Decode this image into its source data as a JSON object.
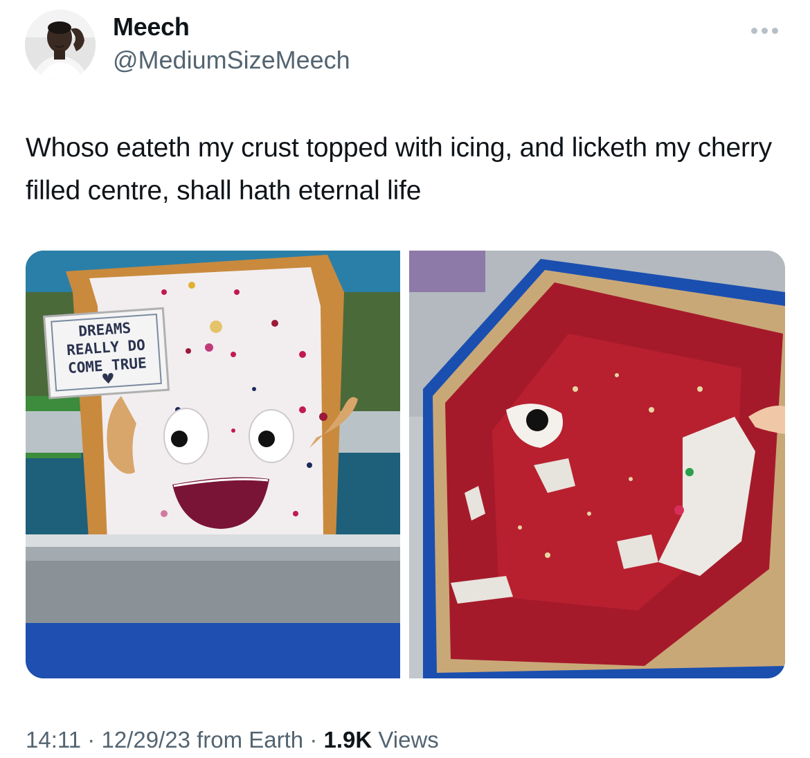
{
  "user": {
    "name": "Meech",
    "handle": "@MediumSizeMeech"
  },
  "tweet": {
    "text": "Whoso eateth my crust topped with icing, and licketh my cherry filled centre, shall hath eternal life"
  },
  "media": {
    "left": {
      "sign_lines": [
        "DREAMS",
        "REALLY DO",
        "COME TRUE"
      ]
    }
  },
  "meta": {
    "time": "14:11",
    "separator": " · ",
    "date": "12/29/23",
    "source": " from Earth",
    "views_count": "1.9K",
    "views_label": " Views"
  },
  "icons": {
    "more": "more-horizontal-icon"
  },
  "colors": {
    "text_primary": "#0f1419",
    "text_secondary": "#536471",
    "background": "#ffffff"
  }
}
